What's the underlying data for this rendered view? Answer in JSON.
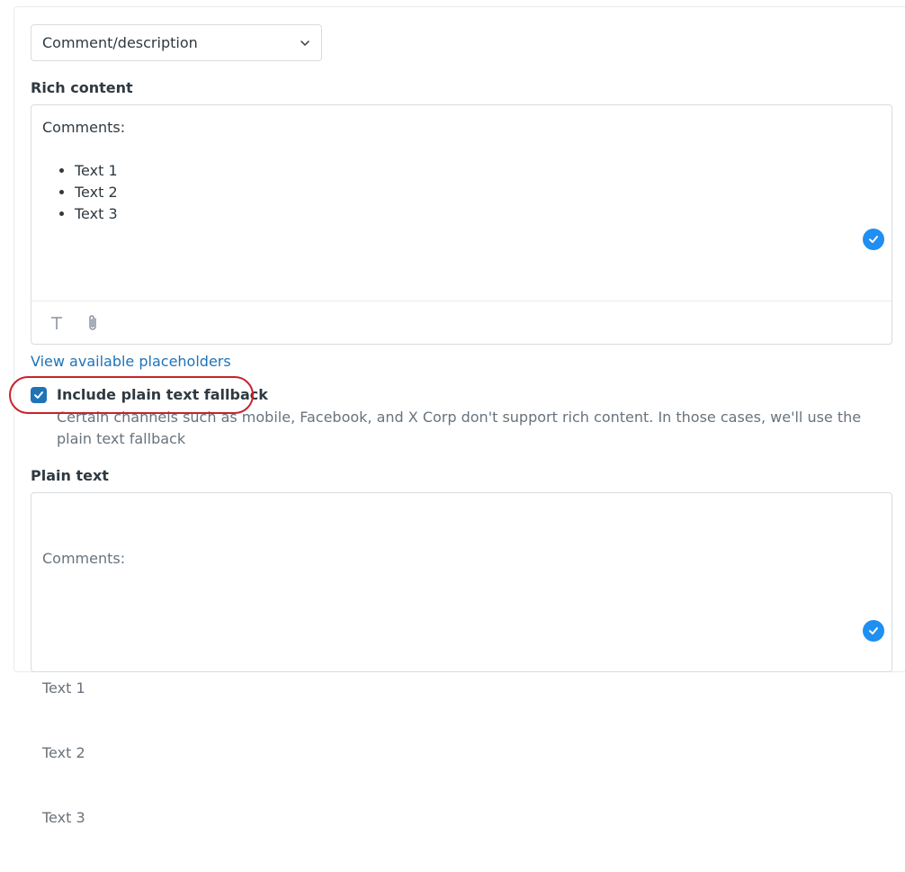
{
  "select": {
    "value": "Comment/description",
    "icon": "chevron-down-icon"
  },
  "rich_content": {
    "label": "Rich content",
    "heading": "Comments:",
    "items": [
      "Text 1",
      "Text 2",
      "Text 3"
    ],
    "toolbar": {
      "text_icon": "text-format-icon",
      "attach_icon": "paperclip-icon"
    },
    "status_icon": "check-circle-icon"
  },
  "placeholders_link": "View available placeholders",
  "fallback": {
    "checked": true,
    "label": "Include plain text fallback",
    "hint": "Certain channels such as mobile, Facebook, and X Corp don't support rich content. In those cases, we'll use the plain text fallback"
  },
  "plain_text": {
    "label": "Plain text",
    "lines": [
      "Comments:",
      "",
      "Text 1",
      "Text 2",
      "Text 3"
    ],
    "status_icon": "check-circle-icon"
  },
  "colors": {
    "accent": "#1f73b7",
    "badge": "#1f8ff2",
    "annotation": "#c8222a"
  }
}
